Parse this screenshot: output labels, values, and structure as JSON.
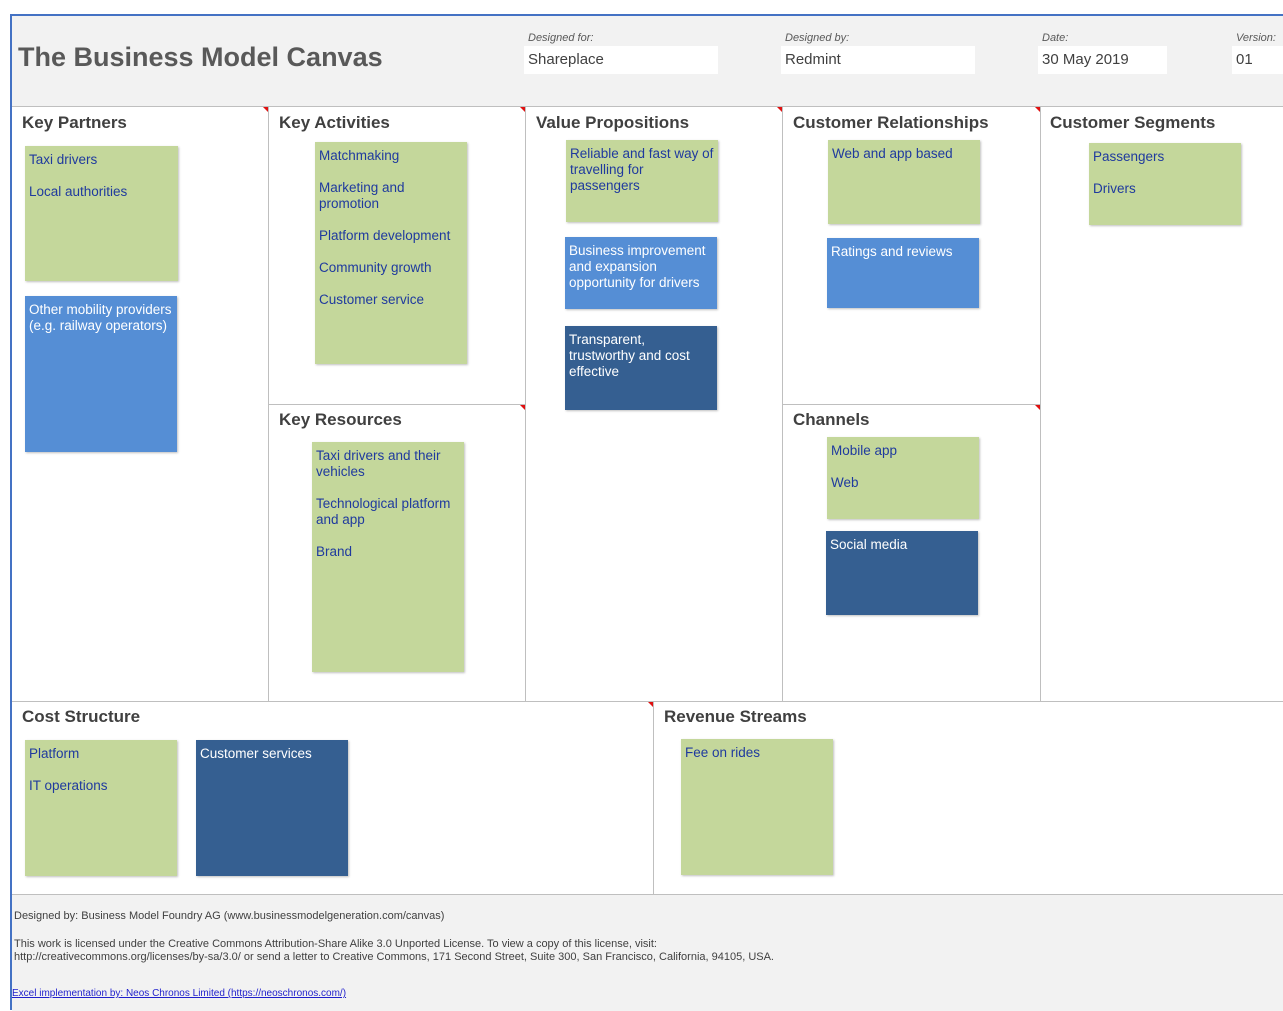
{
  "header": {
    "title": "The Business Model Canvas",
    "designed_for_label": "Designed for:",
    "designed_for_value": "Shareplace",
    "designed_by_label": "Designed by:",
    "designed_by_value": "Redmint",
    "date_label": "Date:",
    "date_value": "30 May 2019",
    "version_label": "Version:",
    "version_value": "01"
  },
  "sections": {
    "key_partners": {
      "title": "Key Partners",
      "notes": [
        {
          "color": "green",
          "items": [
            "Taxi drivers",
            "Local authorities"
          ]
        },
        {
          "color": "lblue",
          "items": [
            "Other  mobility providers (e.g. railway operators)"
          ]
        }
      ]
    },
    "key_activities": {
      "title": "Key Activities",
      "notes": [
        {
          "color": "green",
          "items": [
            "Matchmaking",
            "Marketing and promotion",
            "Platform development",
            "Community growth",
            "Customer service"
          ]
        }
      ]
    },
    "key_resources": {
      "title": "Key Resources",
      "notes": [
        {
          "color": "green",
          "items": [
            "Taxi drivers and their vehicles",
            "Technological platform and app",
            "Brand"
          ]
        }
      ]
    },
    "value_propositions": {
      "title": "Value Propositions",
      "notes": [
        {
          "color": "green",
          "items": [
            "Reliable and fast way of travelling for passengers"
          ]
        },
        {
          "color": "lblue",
          "items": [
            "Business improvement and expansion opportunity for drivers"
          ]
        },
        {
          "color": "dblue",
          "items": [
            "Transparent, trustworthy and cost effective"
          ]
        }
      ]
    },
    "customer_relationships": {
      "title": "Customer Relationships",
      "notes": [
        {
          "color": "green",
          "items": [
            "Web and app based"
          ]
        },
        {
          "color": "lblue",
          "items": [
            "Ratings and reviews"
          ]
        }
      ]
    },
    "channels": {
      "title": "Channels",
      "notes": [
        {
          "color": "green",
          "items": [
            "Mobile app",
            "Web"
          ]
        },
        {
          "color": "dblue",
          "items": [
            "Social media"
          ]
        }
      ]
    },
    "customer_segments": {
      "title": "Customer Segments",
      "notes": [
        {
          "color": "green",
          "items": [
            "Passengers",
            "Drivers"
          ]
        }
      ]
    },
    "cost_structure": {
      "title": "Cost Structure",
      "notes": [
        {
          "color": "green",
          "items": [
            "Platform",
            "IT operations"
          ]
        },
        {
          "color": "dblue",
          "items": [
            "Customer services"
          ]
        }
      ]
    },
    "revenue_streams": {
      "title": "Revenue Streams",
      "notes": [
        {
          "color": "green",
          "items": [
            "Fee on rides"
          ]
        }
      ]
    }
  },
  "footer": {
    "designed_by": "Designed by: Business Model Foundry AG (www.businessmodelgeneration.com/canvas)",
    "license_line1": "This work is licensed under the Creative Commons Attribution-Share Alike 3.0 Unported License. To view a copy of this license, visit:",
    "license_line2": "http://creativecommons.org/licenses/by-sa/3.0/ or send a letter to Creative Commons, 171 Second Street, Suite 300, San Francisco, California, 94105, USA.",
    "excel_link": "Excel implementation by: Neos Chronos Limited (https://neoschronos.com/)"
  }
}
